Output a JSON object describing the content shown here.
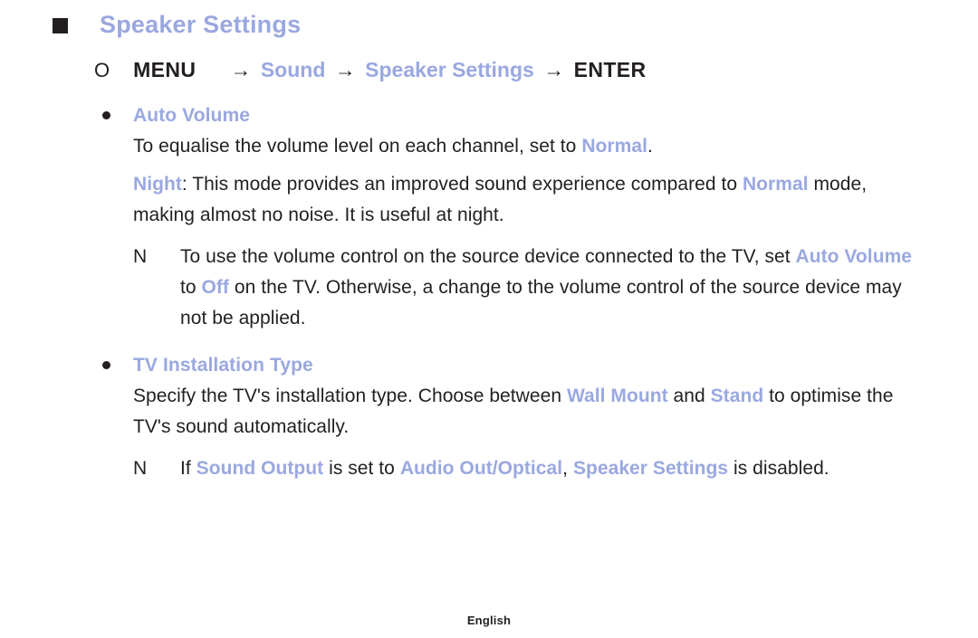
{
  "theme": {
    "background": "#ffffff",
    "text_color": "#231f20",
    "accent_blue": "#9aa8e0"
  },
  "header": {
    "square_icon": "filled-square-icon",
    "title": "Speaker Settings"
  },
  "menu_path": {
    "circle_icon": "O",
    "menu_label": "MENU",
    "arrow": "→",
    "step_1": "Sound",
    "step_2": "Speaker Settings",
    "enter_label": "ENTER"
  },
  "sections": [
    {
      "bullet": "●",
      "label": "Auto Volume",
      "paragraphs": [
        {
          "id": "auto-volume-p1",
          "runs": [
            {
              "text": "To equalise the volume level on each channel, set to ",
              "style": "normal"
            },
            {
              "text": "Normal",
              "style": "accent"
            },
            {
              "text": ".",
              "style": "normal"
            }
          ]
        },
        {
          "id": "auto-volume-p2",
          "runs": [
            {
              "text": "Night",
              "style": "accent"
            },
            {
              "text": ": This mode provides an improved sound experience compared to ",
              "style": "normal"
            },
            {
              "text": "Normal",
              "style": "accent"
            },
            {
              "text": " mode, making almost no noise. It is useful at night.",
              "style": "normal"
            }
          ]
        }
      ],
      "notes": [
        {
          "id": "auto-volume-note",
          "marker": "N",
          "runs": [
            {
              "text": "To use the volume control on the source device connected to the TV, set ",
              "style": "normal"
            },
            {
              "text": "Auto Volume",
              "style": "accent"
            },
            {
              "text": " to ",
              "style": "normal"
            },
            {
              "text": "Off",
              "style": "accent"
            },
            {
              "text": " on the TV. Otherwise, a change to the volume control of the source device may not be applied.",
              "style": "normal"
            }
          ]
        }
      ]
    },
    {
      "bullet": "●",
      "label": "TV Installation Type",
      "paragraphs": [
        {
          "id": "tv-install-p1",
          "runs": [
            {
              "text": "Specify the TV's installation type. Choose between ",
              "style": "normal"
            },
            {
              "text": "Wall Mount",
              "style": "accent"
            },
            {
              "text": " and ",
              "style": "normal"
            },
            {
              "text": "Stand",
              "style": "accent"
            },
            {
              "text": " to optimise the TV's sound automatically.",
              "style": "normal"
            }
          ]
        }
      ],
      "notes": [
        {
          "id": "tv-install-note",
          "marker": "N",
          "runs": [
            {
              "text": "If ",
              "style": "normal"
            },
            {
              "text": "Sound Output",
              "style": "accent"
            },
            {
              "text": " is set to ",
              "style": "normal"
            },
            {
              "text": "Audio Out/Optical",
              "style": "accent"
            },
            {
              "text": ", ",
              "style": "normal"
            },
            {
              "text": "Speaker Settings",
              "style": "accent"
            },
            {
              "text": " is disabled.",
              "style": "normal"
            }
          ]
        }
      ]
    }
  ],
  "footer": {
    "language": "English"
  }
}
